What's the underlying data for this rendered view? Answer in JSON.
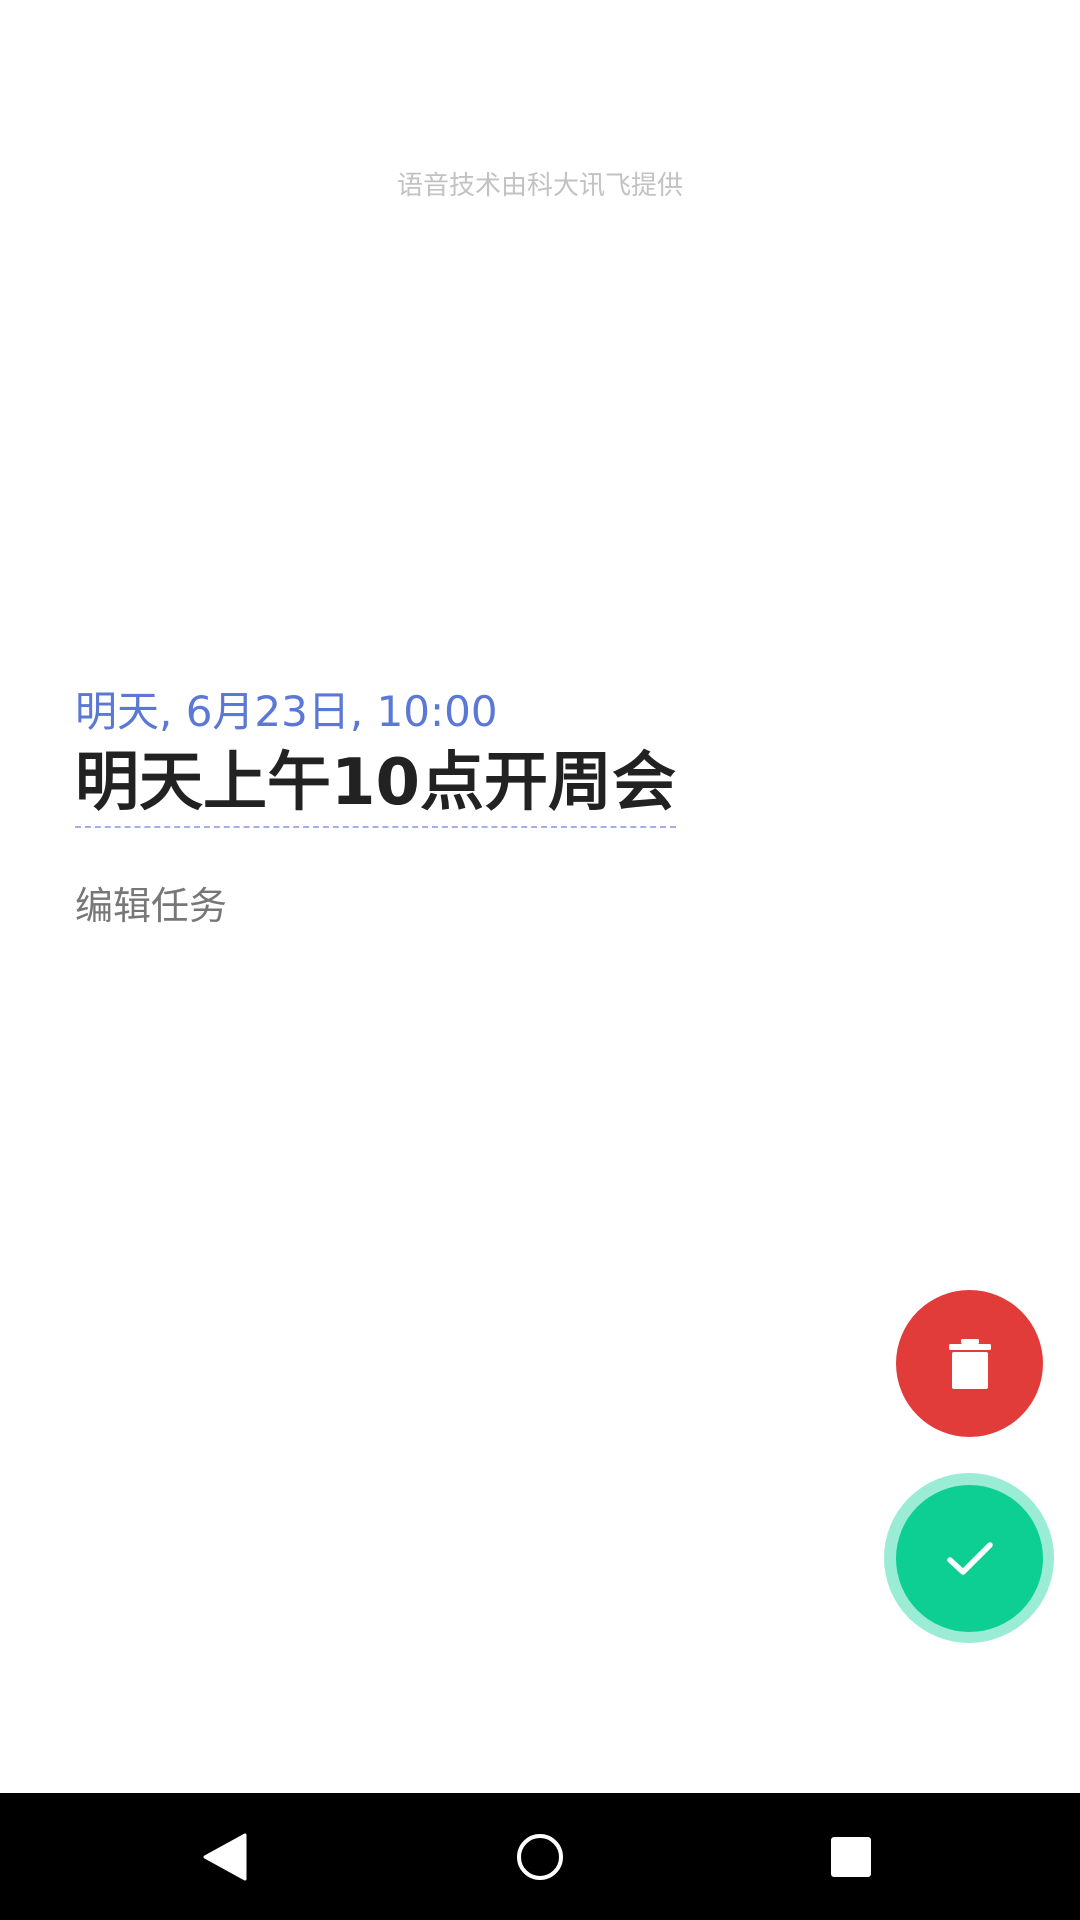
{
  "header": {
    "credit_text": "语音技术由科大讯飞提供"
  },
  "task": {
    "datetime": "明天, 6月23日, 10:00",
    "title": "明天上午10点开周会",
    "edit_label": "编辑任务"
  },
  "actions": {
    "delete_icon": "trash-icon",
    "confirm_icon": "check-icon"
  },
  "navigation": {
    "back_icon": "back-triangle-icon",
    "home_icon": "home-circle-icon",
    "recents_icon": "recents-square-icon"
  },
  "colors": {
    "datetime": "#5b78d6",
    "delete": "#e23c3a",
    "confirm": "#0ecf93",
    "confirm_ring": "#9aecd5",
    "nav_bar": "#000000"
  }
}
